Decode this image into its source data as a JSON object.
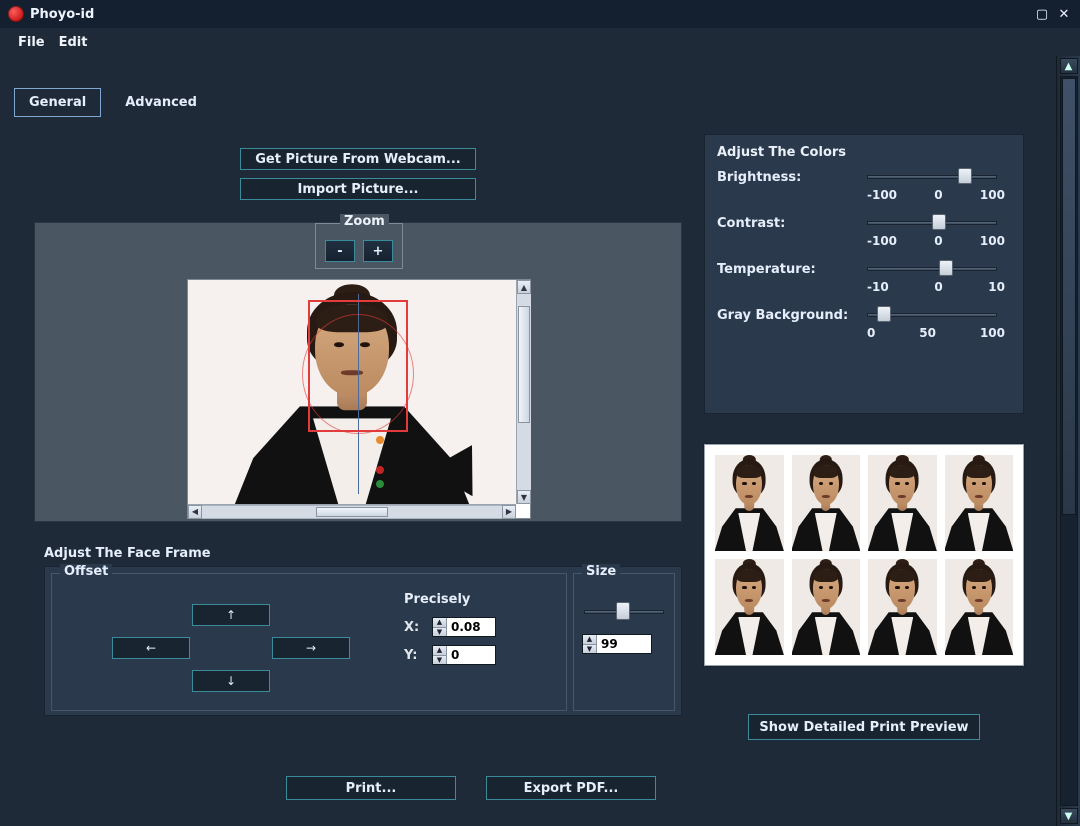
{
  "app": {
    "title": "Phoyo-id"
  },
  "menu": {
    "file": "File",
    "edit": "Edit"
  },
  "tabs": {
    "general": "General",
    "advanced": "Advanced"
  },
  "buttons": {
    "webcam": "Get Picture From Webcam...",
    "import": "Import Picture...",
    "print": "Print...",
    "export_pdf": "Export PDF...",
    "detailed_preview": "Show Detailed Print Preview"
  },
  "zoom": {
    "label": "Zoom",
    "minus": "-",
    "plus": "+"
  },
  "face_frame": {
    "title": "Adjust The Face Frame",
    "offset_label": "Offset",
    "precisely_label": "Precisely",
    "size_label": "Size",
    "arrows": {
      "up": "↑",
      "down": "↓",
      "left": "←",
      "right": "→"
    },
    "x_label": "X:",
    "y_label": "Y:",
    "x_value": "0.08",
    "y_value": "0",
    "size_value": "99",
    "size_slider_pct": 40
  },
  "colors": {
    "title": "Adjust The Colors",
    "rows": [
      {
        "label": "Brightness:",
        "min": "-100",
        "mid": "0",
        "max": "100",
        "thumb_pct": 70
      },
      {
        "label": "Contrast:",
        "min": "-100",
        "mid": "0",
        "max": "100",
        "thumb_pct": 50
      },
      {
        "label": "Temperature:",
        "min": "-10",
        "mid": "0",
        "max": "10",
        "thumb_pct": 55
      },
      {
        "label": "Gray Background:",
        "min": "0",
        "mid": "50",
        "max": "100",
        "thumb_pct": 8
      }
    ]
  },
  "preview": {
    "rows": 2,
    "cols": 4
  }
}
